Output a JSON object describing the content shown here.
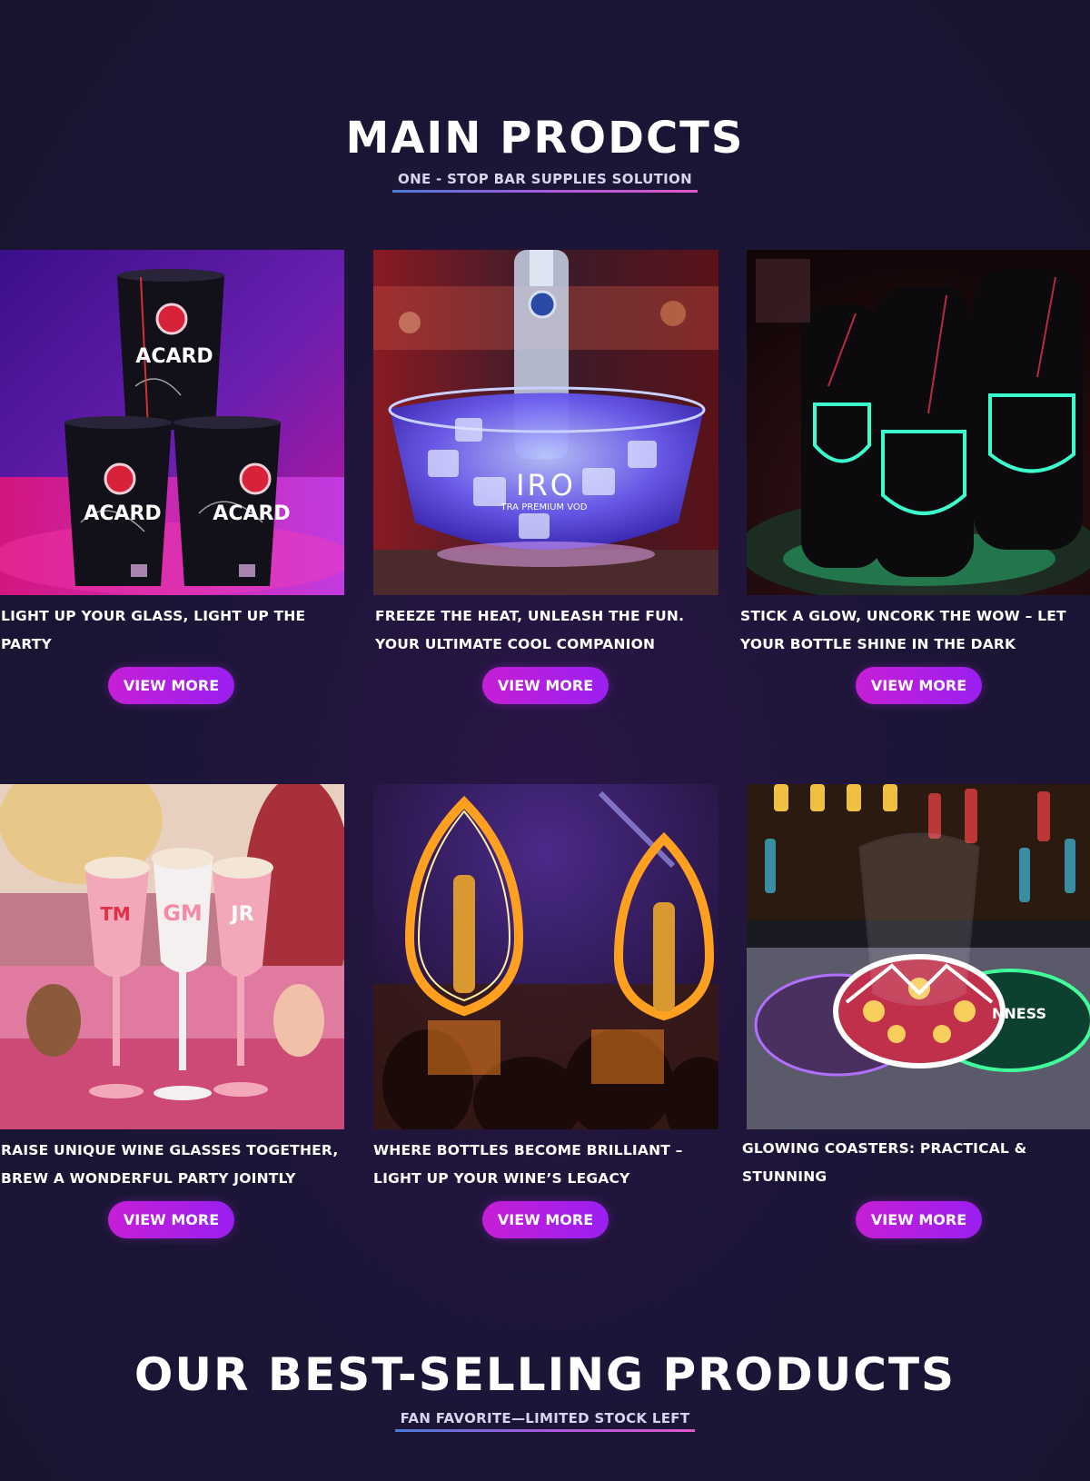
{
  "main_section": {
    "title": "MAIN PRODCTS",
    "subtitle": "ONE - STOP BAR SUPPLIES SOLUTION"
  },
  "products": [
    {
      "caption": "LIGHT UP YOUR GLASS, LIGHT UP THE PARTY",
      "button": "VIEW MORE",
      "image_text": [
        "ACARD",
        "ACARD",
        "ACARD"
      ]
    },
    {
      "caption": "FREEZE THE HEAT, UNLEASH THE FUN. YOUR ULTIMATE COOL COMPANION",
      "button": "VIEW MORE",
      "image_text": [
        "IRO",
        "TRA PREMIUM VOD"
      ]
    },
    {
      "caption": "STICK A GLOW, UNCORK THE WOW – LET YOUR BOTTLE SHINE IN THE DARK",
      "button": "VIEW MORE",
      "image_text": []
    },
    {
      "caption": "RAISE UNIQUE WINE GLASSES TOGETHER, BREW A WONDERFUL PARTY JOINTLY",
      "button": "VIEW MORE",
      "image_text": [
        "TM",
        "GM",
        "JR"
      ]
    },
    {
      "caption": "WHERE BOTTLES BECOME BRILLIANT – LIGHT UP YOUR WINE’S LEGACY",
      "button": "VIEW MORE",
      "image_text": []
    },
    {
      "caption": "GLOWING COASTERS: PRACTICAL & STUNNING",
      "button": "VIEW MORE",
      "image_text": [
        "NNESS"
      ]
    }
  ],
  "bestselling_section": {
    "title": "OUR BEST-SELLING PRODUCTS",
    "subtitle": "FAN FAVORITE—LIMITED STOCK LEFT"
  },
  "colors": {
    "background": "#1d1538",
    "button_start": "#c61fd6",
    "button_end": "#9a1ff0",
    "underline_start": "#4a7bd8",
    "underline_end": "#e058c9"
  }
}
